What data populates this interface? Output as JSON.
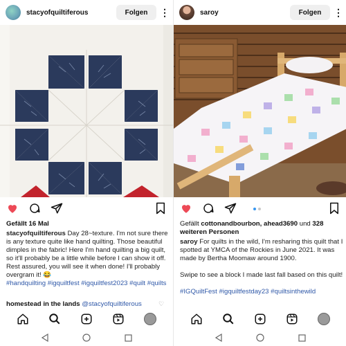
{
  "left": {
    "username": "stacyofquiltiferous",
    "follow_label": "Folgen",
    "likes_text": "Gefällt 16 Mal",
    "caption_user": "stacyofquiltiferous",
    "caption_text": " Day 28~texture. I'm not sure there is any texture quite like hand quilting. Those beautiful dimples in the fabric! Here I'm hand quilting a big quilt, so it'll probably be a little while before I can show it off. Rest assured, you will see it when done! I'll probably overgram it! 😂",
    "hashtags": "#handquilting #igquiltfest #igquiltfest2023 #quilt #quilts",
    "comment_user": "homestead in the lands",
    "comment_mention": "@stacyofquiltiferous"
  },
  "right": {
    "username": "saroy",
    "follow_label": "Folgen",
    "likes_prefix": "Gefällt ",
    "likes_names": "cottonandbourbon, ahead3690",
    "likes_mid": " und ",
    "likes_count": "328 weiteren Personen",
    "caption_user": "saroy",
    "caption_text": " For quilts in the wild, I'm resharing this quilt that I spotted at YMCA of the Rockies in June 2021. It was made by Bertha Moomaw around 1900.",
    "caption_text2": "Swipe to see a block I made last fall based on this quilt!",
    "hashtags": "#IGQuiltFest #igquiltfestday23 #quiltsinthewild"
  },
  "colors": {
    "like_red": "#ed4956",
    "link_blue": "#2f58a8",
    "carousel_active": "#3897f0",
    "navy_fabric": "#2b3a5c",
    "follow_bg": "#efefef"
  },
  "icons": [
    "heart-icon",
    "comment-icon",
    "share-icon",
    "bookmark-icon",
    "home-icon",
    "search-icon",
    "create-icon",
    "reels-icon",
    "profile-avatar",
    "back-icon",
    "home-circle-icon",
    "recents-icon",
    "more-icon"
  ]
}
